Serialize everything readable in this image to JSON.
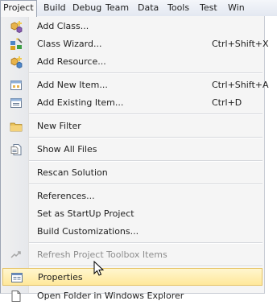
{
  "menubar": {
    "items": [
      "Project",
      "Build",
      "Debug",
      "Team",
      "Data",
      "Tools",
      "Test",
      "Win"
    ]
  },
  "menu": {
    "items": [
      {
        "label": "Add Class...",
        "icon": "add-class-icon"
      },
      {
        "label": "Class Wizard...",
        "shortcut": "Ctrl+Shift+X",
        "icon": "class-wizard-icon"
      },
      {
        "label": "Add Resource...",
        "icon": "add-resource-icon"
      },
      {
        "label": "Add New Item...",
        "shortcut": "Ctrl+Shift+A",
        "icon": "new-item-icon"
      },
      {
        "label": "Add Existing Item...",
        "shortcut": "Ctrl+D",
        "icon": "existing-item-icon"
      },
      {
        "label": "New Filter",
        "icon": "folder-icon"
      },
      {
        "label": "Show All Files",
        "icon": "show-all-files-icon"
      },
      {
        "label": "Rescan Solution"
      },
      {
        "label": "References..."
      },
      {
        "label": "Set as StartUp Project"
      },
      {
        "label": "Build Customizations..."
      },
      {
        "label": "Refresh Project Toolbox Items",
        "icon": "refresh-toolbox-icon",
        "disabled": true
      },
      {
        "label": "Properties",
        "icon": "properties-icon",
        "highlighted": true
      },
      {
        "label": "Open Folder in Windows Explorer",
        "icon": "open-folder-icon"
      }
    ]
  },
  "colors": {
    "highlight": "#ffe89a",
    "highlight_border": "#e5c365",
    "menu_background": "#f5f5f5",
    "disabled_text": "#8d8d8d"
  }
}
